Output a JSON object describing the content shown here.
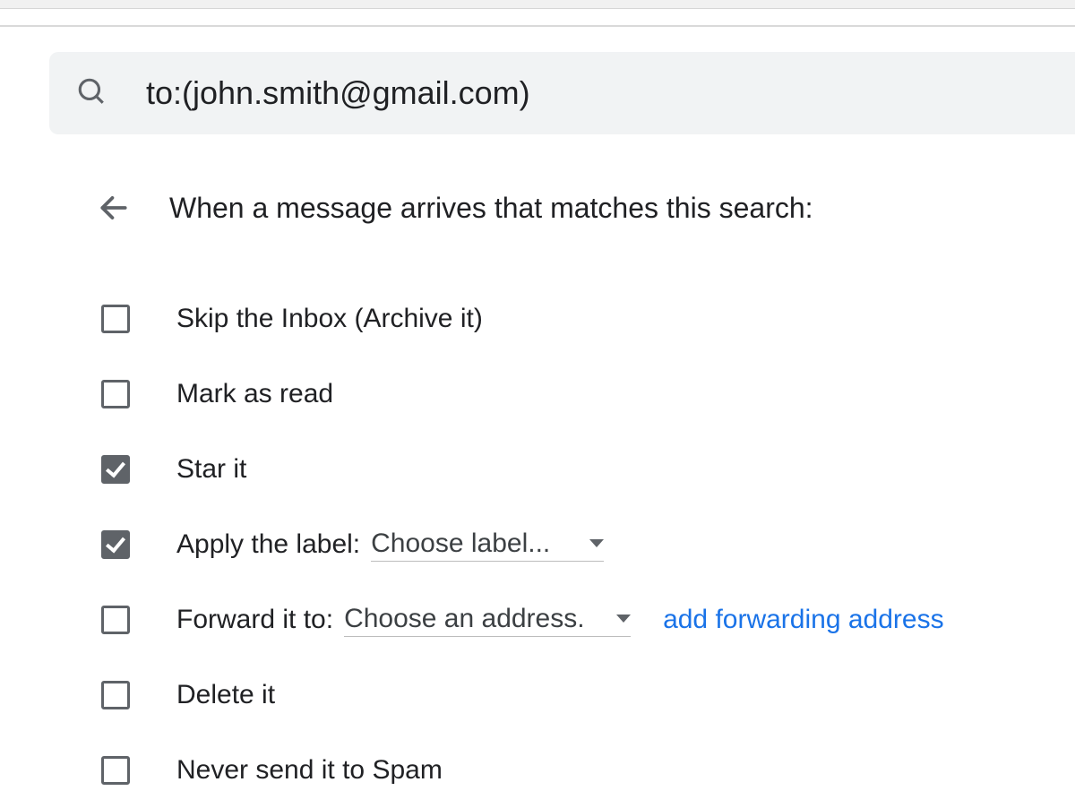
{
  "search": {
    "query": "to:(john.smith@gmail.com)"
  },
  "panel": {
    "heading": "When a message arrives that matches this search:",
    "options": {
      "skip_inbox": {
        "label": "Skip the Inbox (Archive it)",
        "checked": false
      },
      "mark_read": {
        "label": "Mark as read",
        "checked": false
      },
      "star_it": {
        "label": "Star it",
        "checked": true
      },
      "apply_label": {
        "label": "Apply the label:",
        "checked": true,
        "dropdown": "Choose label..."
      },
      "forward": {
        "label": "Forward it to:",
        "checked": false,
        "dropdown": "Choose an address.",
        "link": "add forwarding address"
      },
      "delete_it": {
        "label": "Delete it",
        "checked": false
      },
      "never_spam": {
        "label": "Never send it to Spam",
        "checked": false
      }
    }
  }
}
